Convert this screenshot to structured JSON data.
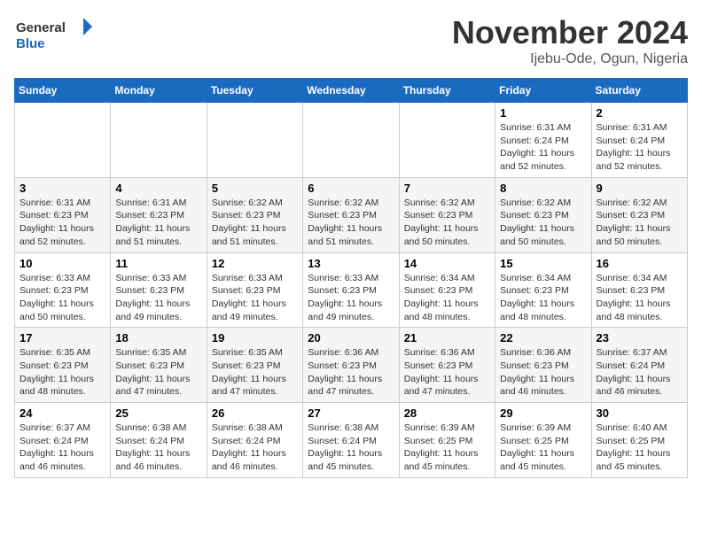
{
  "header": {
    "logo_general": "General",
    "logo_blue": "Blue",
    "month_year": "November 2024",
    "location": "Ijebu-Ode, Ogun, Nigeria"
  },
  "days_of_week": [
    "Sunday",
    "Monday",
    "Tuesday",
    "Wednesday",
    "Thursday",
    "Friday",
    "Saturday"
  ],
  "weeks": [
    [
      {
        "day": "",
        "info": ""
      },
      {
        "day": "",
        "info": ""
      },
      {
        "day": "",
        "info": ""
      },
      {
        "day": "",
        "info": ""
      },
      {
        "day": "",
        "info": ""
      },
      {
        "day": "1",
        "info": "Sunrise: 6:31 AM\nSunset: 6:24 PM\nDaylight: 11 hours\nand 52 minutes."
      },
      {
        "day": "2",
        "info": "Sunrise: 6:31 AM\nSunset: 6:24 PM\nDaylight: 11 hours\nand 52 minutes."
      }
    ],
    [
      {
        "day": "3",
        "info": "Sunrise: 6:31 AM\nSunset: 6:23 PM\nDaylight: 11 hours\nand 52 minutes."
      },
      {
        "day": "4",
        "info": "Sunrise: 6:31 AM\nSunset: 6:23 PM\nDaylight: 11 hours\nand 51 minutes."
      },
      {
        "day": "5",
        "info": "Sunrise: 6:32 AM\nSunset: 6:23 PM\nDaylight: 11 hours\nand 51 minutes."
      },
      {
        "day": "6",
        "info": "Sunrise: 6:32 AM\nSunset: 6:23 PM\nDaylight: 11 hours\nand 51 minutes."
      },
      {
        "day": "7",
        "info": "Sunrise: 6:32 AM\nSunset: 6:23 PM\nDaylight: 11 hours\nand 50 minutes."
      },
      {
        "day": "8",
        "info": "Sunrise: 6:32 AM\nSunset: 6:23 PM\nDaylight: 11 hours\nand 50 minutes."
      },
      {
        "day": "9",
        "info": "Sunrise: 6:32 AM\nSunset: 6:23 PM\nDaylight: 11 hours\nand 50 minutes."
      }
    ],
    [
      {
        "day": "10",
        "info": "Sunrise: 6:33 AM\nSunset: 6:23 PM\nDaylight: 11 hours\nand 50 minutes."
      },
      {
        "day": "11",
        "info": "Sunrise: 6:33 AM\nSunset: 6:23 PM\nDaylight: 11 hours\nand 49 minutes."
      },
      {
        "day": "12",
        "info": "Sunrise: 6:33 AM\nSunset: 6:23 PM\nDaylight: 11 hours\nand 49 minutes."
      },
      {
        "day": "13",
        "info": "Sunrise: 6:33 AM\nSunset: 6:23 PM\nDaylight: 11 hours\nand 49 minutes."
      },
      {
        "day": "14",
        "info": "Sunrise: 6:34 AM\nSunset: 6:23 PM\nDaylight: 11 hours\nand 48 minutes."
      },
      {
        "day": "15",
        "info": "Sunrise: 6:34 AM\nSunset: 6:23 PM\nDaylight: 11 hours\nand 48 minutes."
      },
      {
        "day": "16",
        "info": "Sunrise: 6:34 AM\nSunset: 6:23 PM\nDaylight: 11 hours\nand 48 minutes."
      }
    ],
    [
      {
        "day": "17",
        "info": "Sunrise: 6:35 AM\nSunset: 6:23 PM\nDaylight: 11 hours\nand 48 minutes."
      },
      {
        "day": "18",
        "info": "Sunrise: 6:35 AM\nSunset: 6:23 PM\nDaylight: 11 hours\nand 47 minutes."
      },
      {
        "day": "19",
        "info": "Sunrise: 6:35 AM\nSunset: 6:23 PM\nDaylight: 11 hours\nand 47 minutes."
      },
      {
        "day": "20",
        "info": "Sunrise: 6:36 AM\nSunset: 6:23 PM\nDaylight: 11 hours\nand 47 minutes."
      },
      {
        "day": "21",
        "info": "Sunrise: 6:36 AM\nSunset: 6:23 PM\nDaylight: 11 hours\nand 47 minutes."
      },
      {
        "day": "22",
        "info": "Sunrise: 6:36 AM\nSunset: 6:23 PM\nDaylight: 11 hours\nand 46 minutes."
      },
      {
        "day": "23",
        "info": "Sunrise: 6:37 AM\nSunset: 6:24 PM\nDaylight: 11 hours\nand 46 minutes."
      }
    ],
    [
      {
        "day": "24",
        "info": "Sunrise: 6:37 AM\nSunset: 6:24 PM\nDaylight: 11 hours\nand 46 minutes."
      },
      {
        "day": "25",
        "info": "Sunrise: 6:38 AM\nSunset: 6:24 PM\nDaylight: 11 hours\nand 46 minutes."
      },
      {
        "day": "26",
        "info": "Sunrise: 6:38 AM\nSunset: 6:24 PM\nDaylight: 11 hours\nand 46 minutes."
      },
      {
        "day": "27",
        "info": "Sunrise: 6:38 AM\nSunset: 6:24 PM\nDaylight: 11 hours\nand 45 minutes."
      },
      {
        "day": "28",
        "info": "Sunrise: 6:39 AM\nSunset: 6:25 PM\nDaylight: 11 hours\nand 45 minutes."
      },
      {
        "day": "29",
        "info": "Sunrise: 6:39 AM\nSunset: 6:25 PM\nDaylight: 11 hours\nand 45 minutes."
      },
      {
        "day": "30",
        "info": "Sunrise: 6:40 AM\nSunset: 6:25 PM\nDaylight: 11 hours\nand 45 minutes."
      }
    ]
  ]
}
